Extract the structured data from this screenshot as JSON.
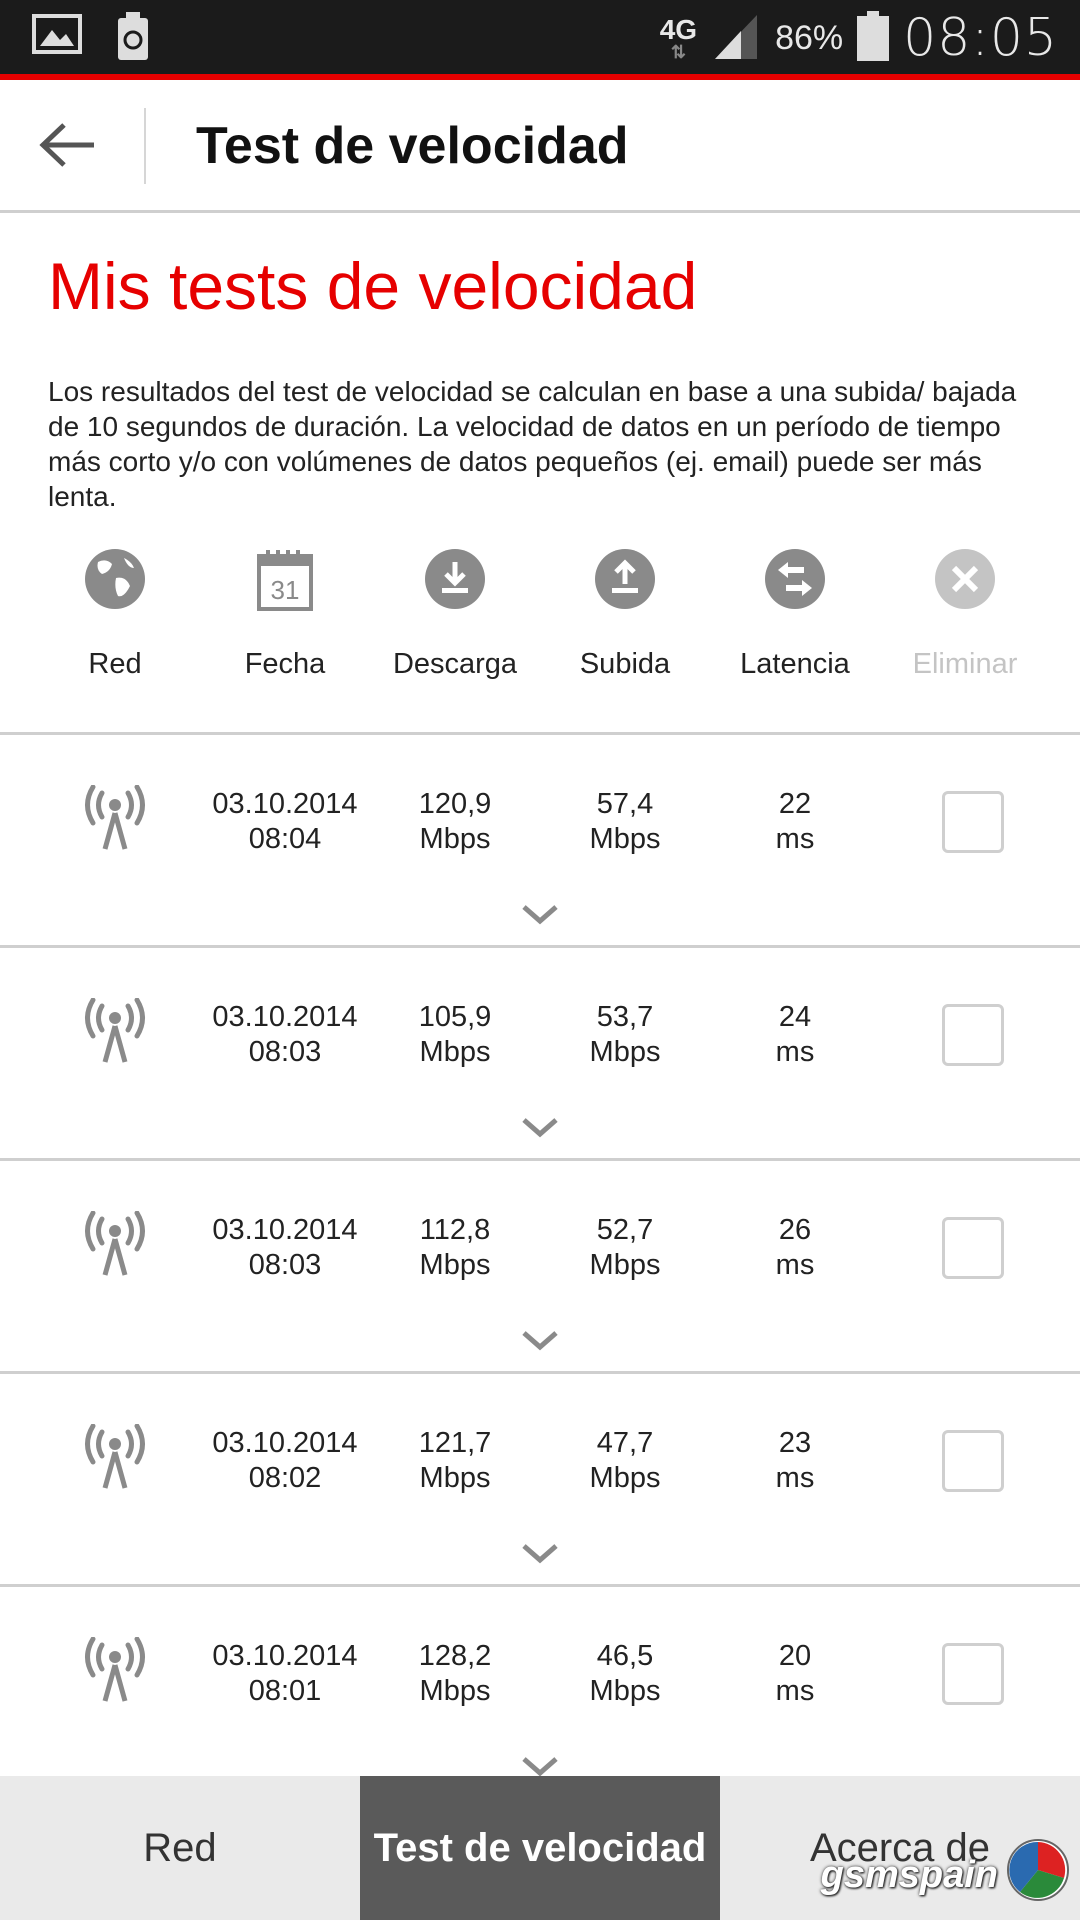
{
  "status_bar": {
    "network": "4G",
    "battery_percent": "86%",
    "time": "08:05"
  },
  "app_bar": {
    "title": "Test de velocidad"
  },
  "heading": "Mis tests de velocidad",
  "description": "Los resultados del test de velocidad se calculan en base a una subida/ bajada de 10 segundos de duración. La velocidad de datos en un período de tiempo más corto y/o con volúmenes de datos pequeños (ej. email) puede ser más lenta.",
  "columns": {
    "network": "Red",
    "date": "Fecha",
    "calendar_day": "31",
    "download": "Descarga",
    "upload": "Subida",
    "latency": "Latencia",
    "delete": "Eliminar"
  },
  "rows": [
    {
      "date": "03.10.2014",
      "time": "08:04",
      "download": "120,9",
      "download_unit": "Mbps",
      "upload": "57,4",
      "upload_unit": "Mbps",
      "latency": "22",
      "latency_unit": "ms"
    },
    {
      "date": "03.10.2014",
      "time": "08:03",
      "download": "105,9",
      "download_unit": "Mbps",
      "upload": "53,7",
      "upload_unit": "Mbps",
      "latency": "24",
      "latency_unit": "ms"
    },
    {
      "date": "03.10.2014",
      "time": "08:03",
      "download": "112,8",
      "download_unit": "Mbps",
      "upload": "52,7",
      "upload_unit": "Mbps",
      "latency": "26",
      "latency_unit": "ms"
    },
    {
      "date": "03.10.2014",
      "time": "08:02",
      "download": "121,7",
      "download_unit": "Mbps",
      "upload": "47,7",
      "upload_unit": "Mbps",
      "latency": "23",
      "latency_unit": "ms"
    },
    {
      "date": "03.10.2014",
      "time": "08:01",
      "download": "128,2",
      "download_unit": "Mbps",
      "upload": "46,5",
      "upload_unit": "Mbps",
      "latency": "20",
      "latency_unit": "ms"
    }
  ],
  "bottom_nav": {
    "tabs": [
      "Red",
      "Test de velocidad",
      "Acerca de"
    ],
    "active": "Test de velocidad"
  },
  "watermark": "gsmspain",
  "colors": {
    "accent": "#e60000",
    "icon_gray": "#8a8a8a",
    "disabled_gray": "#c4c4c4",
    "active_tab": "#5a5a5a"
  }
}
